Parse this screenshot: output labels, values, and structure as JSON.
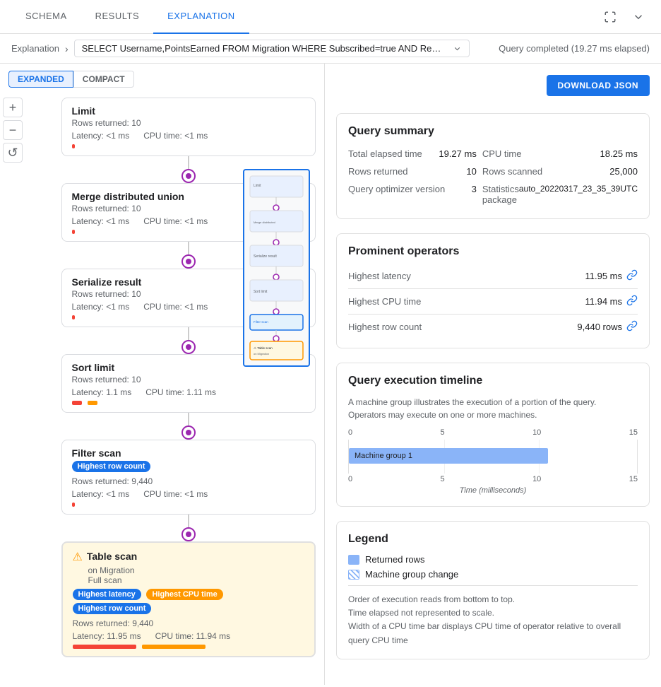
{
  "tabs": [
    {
      "id": "schema",
      "label": "SCHEMA",
      "active": false
    },
    {
      "id": "results",
      "label": "RESULTS",
      "active": false
    },
    {
      "id": "explanation",
      "label": "EXPLANATION",
      "active": true
    }
  ],
  "breadcrumb": {
    "label": "Explanation",
    "chevron": "›",
    "query_text": "SELECT Username,PointsEarned FROM Migration WHERE Subscribed=true AND ReminderD...",
    "query_status": "Query completed (19.27 ms elapsed)"
  },
  "view_toggle": {
    "expanded": "EXPANDED",
    "compact": "COMPACT"
  },
  "zoom": {
    "plus": "+",
    "minus": "−",
    "reset": "↺"
  },
  "operators": [
    {
      "id": "limit",
      "title": "Limit",
      "rows_returned": "Rows returned: 10",
      "latency": "Latency: <1 ms",
      "cpu_time": "CPU time: <1 ms",
      "badges": [],
      "warning": false,
      "sub": null,
      "bar_latency_width": 4,
      "bar_cpu_width": 4
    },
    {
      "id": "merge-distributed-union",
      "title": "Merge distributed union",
      "rows_returned": "Rows returned: 10",
      "latency": "Latency: <1 ms",
      "cpu_time": "CPU time: <1 ms",
      "badges": [],
      "warning": false,
      "sub": null,
      "bar_latency_width": 4,
      "bar_cpu_width": 4
    },
    {
      "id": "serialize-result",
      "title": "Serialize result",
      "rows_returned": "Rows returned: 10",
      "latency": "Latency: <1 ms",
      "cpu_time": "CPU time: <1 ms",
      "badges": [],
      "warning": false,
      "sub": null,
      "bar_latency_width": 4,
      "bar_cpu_width": 4
    },
    {
      "id": "sort-limit",
      "title": "Sort limit",
      "rows_returned": "Rows returned: 10",
      "latency": "Latency: 1.1 ms",
      "cpu_time": "CPU time: 1.11 ms",
      "badges": [],
      "warning": false,
      "sub": null,
      "bar_latency_width": 14,
      "bar_cpu_width": 14
    },
    {
      "id": "filter-scan",
      "title": "Filter scan",
      "rows_returned": "Rows returned: 9,440",
      "latency": "Latency: <1 ms",
      "cpu_time": "CPU time: <1 ms",
      "badges": [
        "Highest row count"
      ],
      "warning": false,
      "sub": null,
      "bar_latency_width": 4,
      "bar_cpu_width": 4
    },
    {
      "id": "table-scan",
      "title": "Table scan",
      "rows_returned": "Rows returned: 9,440",
      "latency": "Latency: 11.95 ms",
      "cpu_time": "CPU time: 11.94 ms",
      "badges": [
        "Highest latency",
        "Highest CPU time",
        "Highest row count"
      ],
      "warning": true,
      "sub": "on Migration\nFull scan",
      "bar_latency_width": 90,
      "bar_cpu_width": 90
    }
  ],
  "download_btn": "DOWNLOAD JSON",
  "query_summary": {
    "title": "Query summary",
    "rows": [
      {
        "key": "Total elapsed time",
        "value": "19.27 ms"
      },
      {
        "key": "CPU time",
        "value": "18.25 ms"
      },
      {
        "key": "Rows returned",
        "value": "10"
      },
      {
        "key": "Rows scanned",
        "value": "25,000"
      },
      {
        "key": "Query optimizer version",
        "value": "3"
      },
      {
        "key": "Statistics package",
        "value": "auto_20220317_23_35_39UTC"
      }
    ]
  },
  "prominent_operators": {
    "title": "Prominent operators",
    "rows": [
      {
        "key": "Highest latency",
        "value": "11.95 ms",
        "link": true
      },
      {
        "key": "Highest CPU time",
        "value": "11.94 ms",
        "link": true
      },
      {
        "key": "Highest row count",
        "value": "9,440 rows",
        "link": true
      }
    ]
  },
  "execution_timeline": {
    "title": "Query execution timeline",
    "description": "A machine group illustrates the execution of a portion of the query.",
    "description2": "Operators may execute on one or more machines.",
    "axis_top": [
      "0",
      "5",
      "10",
      "15"
    ],
    "axis_bottom": [
      "0",
      "5",
      "10",
      "15"
    ],
    "xlabel": "Time (milliseconds)",
    "machine_group": {
      "label": "Machine group 1",
      "start_pct": 0,
      "width_pct": 69
    }
  },
  "legend": {
    "title": "Legend",
    "items": [
      {
        "type": "solid",
        "label": "Returned rows"
      },
      {
        "type": "striped",
        "label": "Machine group change"
      }
    ],
    "note": "Order of execution reads from bottom to top.\nTime elapsed not represented to scale.\nWidth of a CPU time bar displays CPU time of operator relative to overall query CPU time"
  }
}
